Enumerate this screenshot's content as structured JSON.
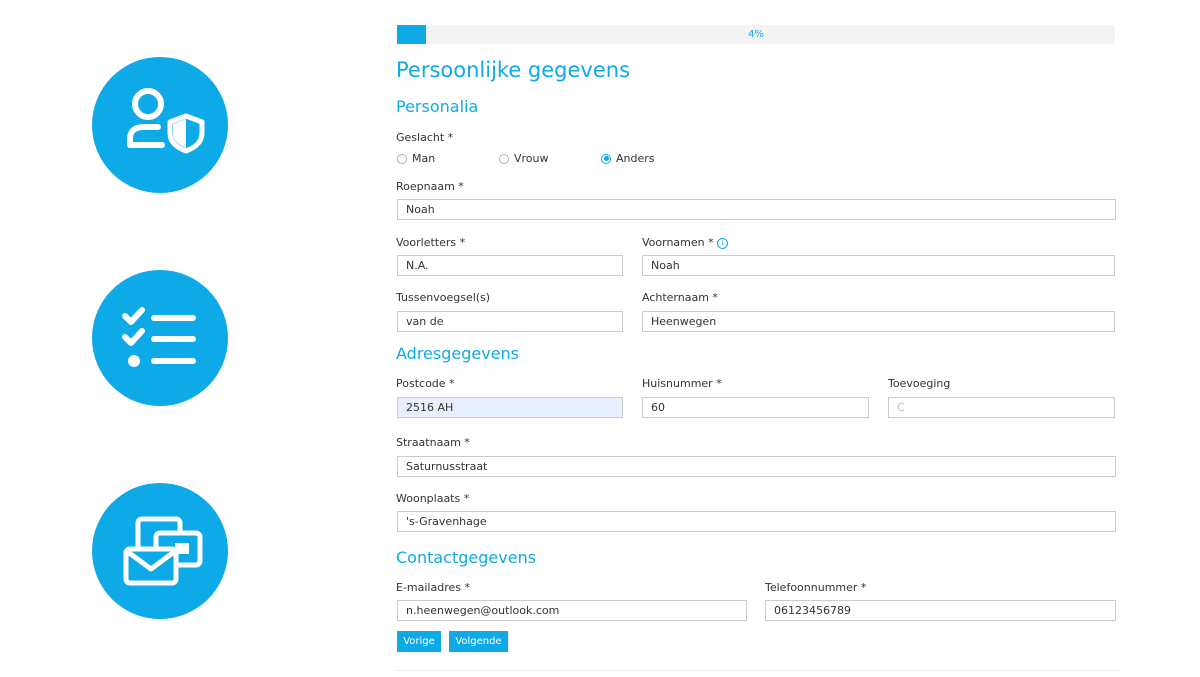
{
  "progress": {
    "value": 0.04,
    "label": "4%"
  },
  "sidebar_icons": [
    "user-shield-icon",
    "checklist-icon",
    "envelope-cards-icon"
  ],
  "page": {
    "title": "Persoonlijke gegevens"
  },
  "personalia": {
    "heading": "Personalia",
    "gender": {
      "label": "Geslacht *",
      "options": [
        "Man",
        "Vrouw",
        "Anders"
      ],
      "selected": "Anders"
    },
    "roepnaam": {
      "label": "Roepnaam *",
      "value": "Noah"
    },
    "voorletters": {
      "label": "Voorletters *",
      "value": "N.A."
    },
    "voornamen": {
      "label": "Voornamen *",
      "value": "Noah"
    },
    "tussenvoegsel": {
      "label": "Tussenvoegsel(s)",
      "value": "van de"
    },
    "achternaam": {
      "label": "Achternaam *",
      "value": "Heenwegen"
    }
  },
  "adres": {
    "heading": "Adresgegevens",
    "postcode": {
      "label": "Postcode *",
      "value": "2516 AH"
    },
    "huisnummer": {
      "label": "Huisnummer *",
      "value": "60"
    },
    "toevoeging": {
      "label": "Toevoeging",
      "placeholder": "C"
    },
    "straatnaam": {
      "label": "Straatnaam *",
      "value": "Saturnusstraat"
    },
    "woonplaats": {
      "label": "Woonplaats *",
      "value": "'s-Gravenhage"
    }
  },
  "contact": {
    "heading": "Contactgegevens",
    "email": {
      "label": "E-mailadres *",
      "value": "n.heenwegen@outlook.com"
    },
    "telefoon": {
      "label": "Telefoonnummer *",
      "value": "06123456789"
    }
  },
  "buttons": {
    "prev": "Vorige",
    "next": "Volgende"
  },
  "colors": {
    "accent": "#0eaae8",
    "autofill": "#e8f0fe",
    "border": "#cccccc"
  }
}
